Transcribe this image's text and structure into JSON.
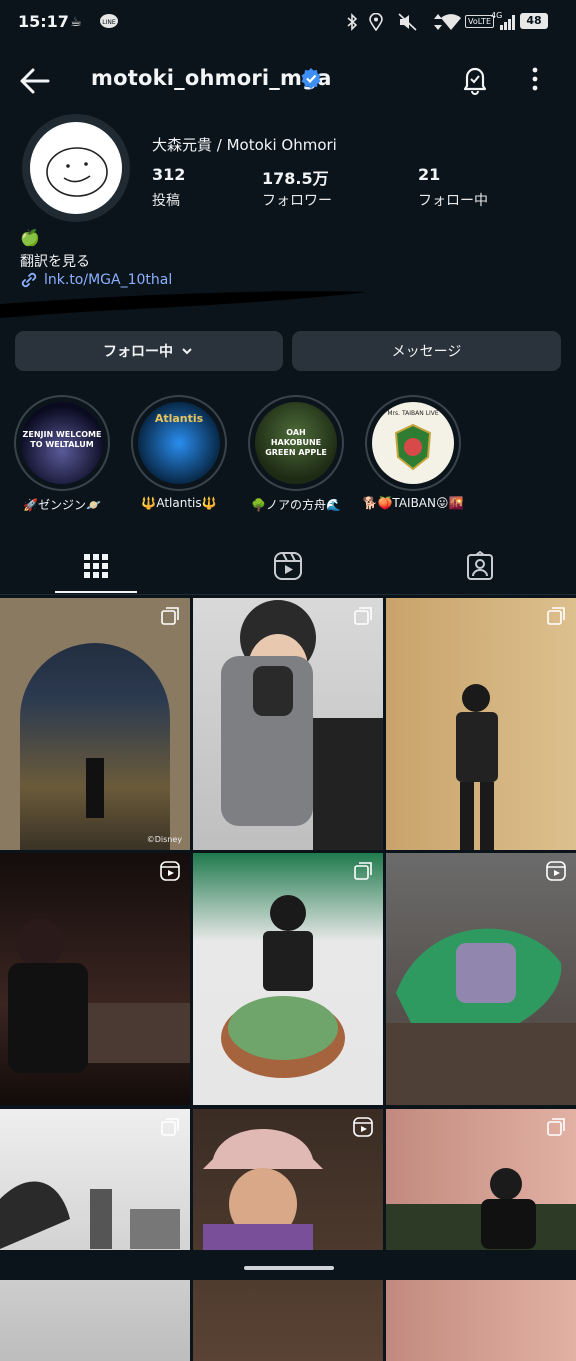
{
  "status_bar": {
    "time": "15:17",
    "volte": "VoLTE",
    "network": "4G",
    "battery": "48"
  },
  "header": {
    "username": "motoki_ohmori_mga"
  },
  "profile": {
    "full_name": "大森元貴 / Motoki Ohmori",
    "stats": [
      {
        "value": "312",
        "label": "投稿"
      },
      {
        "value": "178.5万",
        "label": "フォロワー"
      },
      {
        "value": "21",
        "label": "フォロー中"
      }
    ],
    "bio_emoji": "🍏",
    "translate": "翻訳を見る",
    "link": "lnk.to/MGA_10thal"
  },
  "actions": {
    "following": "フォロー中",
    "message": "メッセージ"
  },
  "highlights": [
    {
      "label": "🚀ゼンジン🪐",
      "art_text": "ZENJIN WELCOME TO WELTALUM"
    },
    {
      "label": "🔱Atlantis🔱",
      "art_text": "Atlantis"
    },
    {
      "label": "🌳ノアの方舟🌊",
      "art_text": "OAH HAKOBUNE GREEN APPLE"
    },
    {
      "label": "🐕🍑TAIBAN😛🌇",
      "art_text": "Mrs. TAIBAN LIVE"
    }
  ],
  "posts": [
    {
      "type": "carousel",
      "caption": "©Disney"
    },
    {
      "type": "carousel",
      "caption": ""
    },
    {
      "type": "carousel",
      "caption": ""
    },
    {
      "type": "reel",
      "caption": ""
    },
    {
      "type": "carousel",
      "caption": ""
    },
    {
      "type": "reel",
      "caption": ""
    },
    {
      "type": "carousel",
      "caption": ""
    },
    {
      "type": "reel",
      "caption": ""
    },
    {
      "type": "carousel",
      "caption": ""
    }
  ]
}
